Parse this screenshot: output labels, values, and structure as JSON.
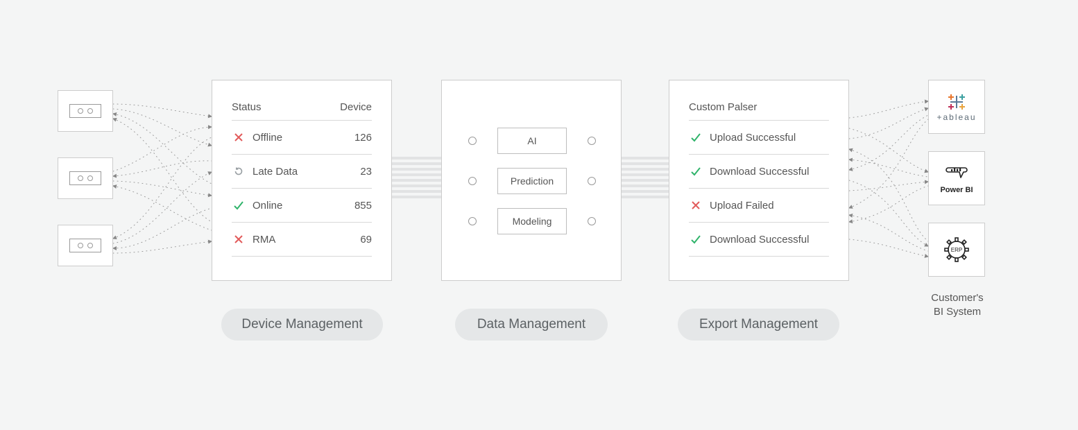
{
  "devicePanel": {
    "headerStatus": "Status",
    "headerDevice": "Device",
    "rows": [
      {
        "icon": "cross",
        "label": "Offline",
        "count": "126"
      },
      {
        "icon": "refresh",
        "label": "Late Data",
        "count": "23"
      },
      {
        "icon": "check",
        "label": "Online",
        "count": "855"
      },
      {
        "icon": "cross",
        "label": "RMA",
        "count": "69"
      }
    ]
  },
  "dataPanel": {
    "nodes": {
      "ai": "AI",
      "prediction": "Prediction",
      "modeling": "Modeling"
    }
  },
  "exportPanel": {
    "title": "Custom Palser",
    "rows": [
      {
        "icon": "check",
        "label": "Upload Successful"
      },
      {
        "icon": "check",
        "label": "Download Successful"
      },
      {
        "icon": "cross",
        "label": "Upload Failed"
      },
      {
        "icon": "check",
        "label": "Download Successful"
      }
    ]
  },
  "chips": {
    "device": "Device Management",
    "data": "Data Management",
    "export": "Export Management"
  },
  "biSystems": {
    "tableau": "+ableau",
    "powerbi": "Power BI",
    "erp": "ERP",
    "caption1": "Customer's",
    "caption2": "BI System"
  }
}
